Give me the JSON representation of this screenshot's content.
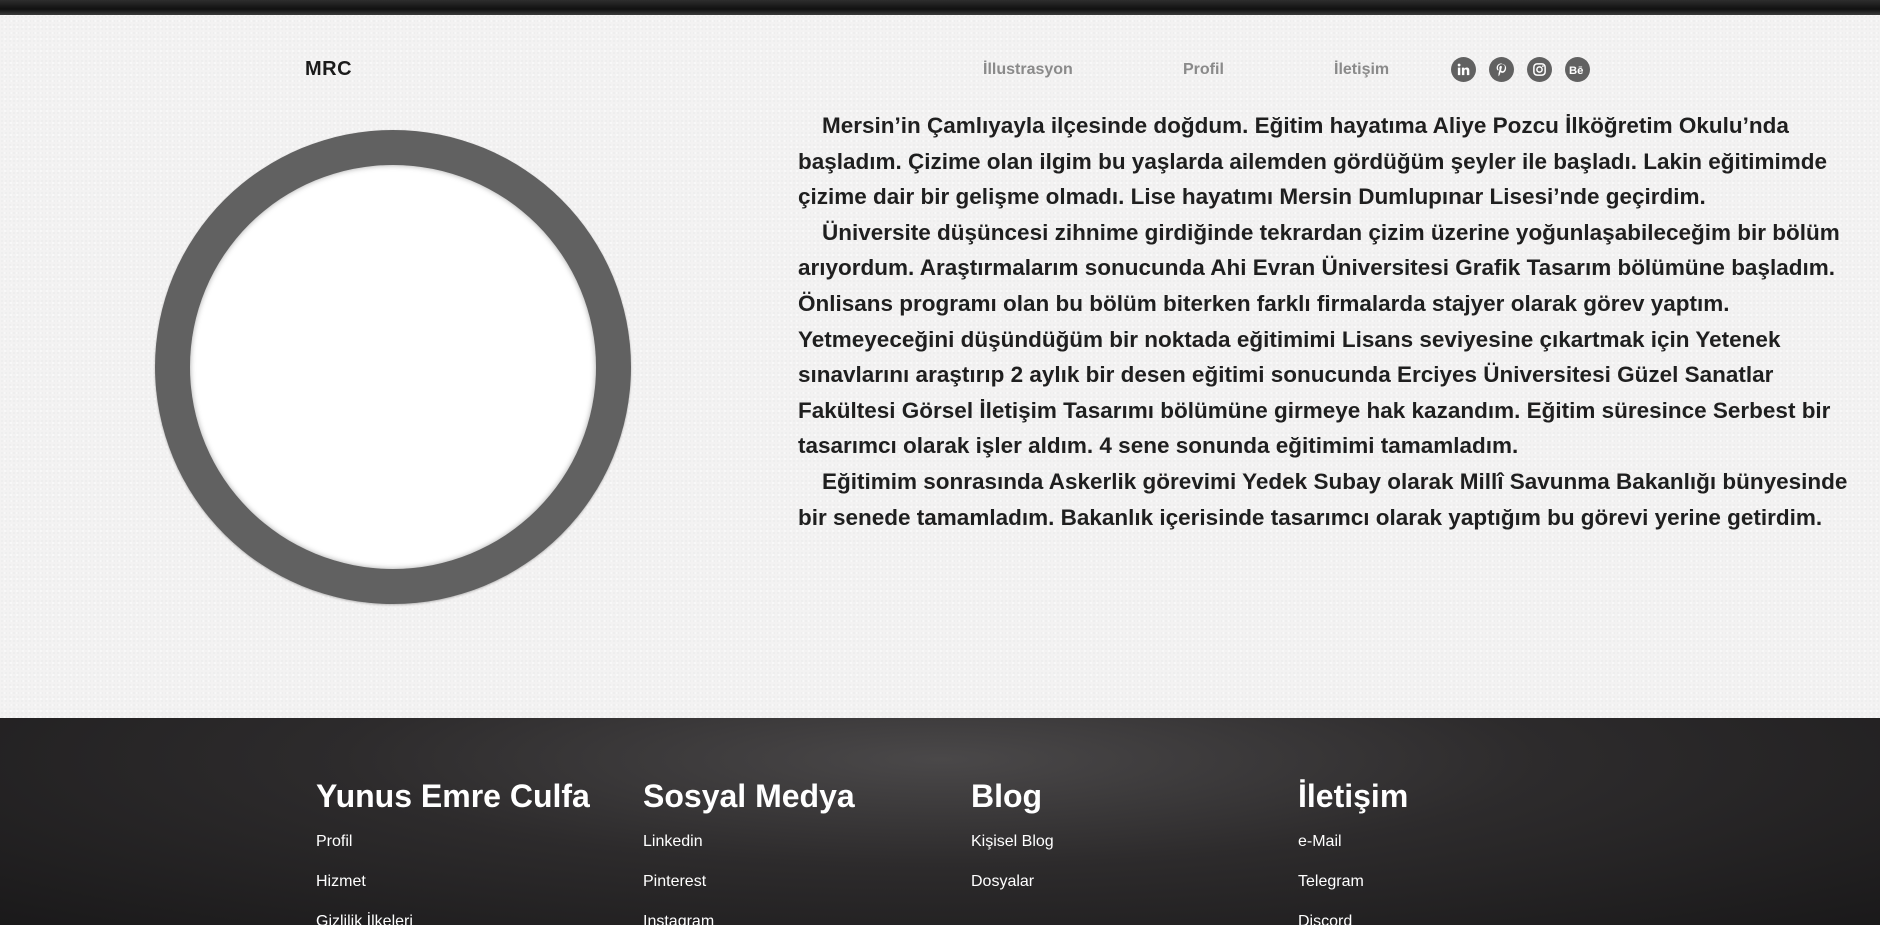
{
  "header": {
    "logo": "MRC",
    "nav": [
      "İllustrasyon",
      "Profil",
      "İletişim"
    ],
    "social_icons": [
      "linkedin-icon",
      "pinterest-icon",
      "instagram-icon",
      "behance-icon"
    ]
  },
  "bio": {
    "paragraphs": [
      "Mersin’in Çamlıyayla ilçesinde doğdum. Eğitim hayatıma Aliye Pozcu İlköğretim Okulu’nda başladım. Çizime olan ilgim bu yaşlarda ailemden gördüğüm şeyler ile başladı. Lakin eğitimimde çizime dair bir gelişme olmadı. Lise hayatımı Mersin Dumlupınar Lisesi’nde geçirdim.",
      "Üniversite düşüncesi zihnime girdiğinde tekrardan çizim üzerine yoğunlaşabileceğim bir bölüm arıyordum. Araştırmalarım sonucunda Ahi Evran Üniversitesi Grafik Tasarım bölümüne başladım. Önlisans programı olan bu bölüm biterken farklı firmalarda stajyer olarak görev yaptım. Yetmeyeceğini düşündüğüm bir noktada eğitimimi Lisans seviyesine çıkartmak için Yetenek sınavlarını araştırıp 2 aylık bir desen eğitimi sonucunda Erciyes Üniversitesi Güzel Sanatlar Fakültesi Görsel İletişim Tasarımı bölümüne girmeye hak kazandım. Eğitim süresince Serbest bir tasarımcı olarak işler aldım. 4 sene sonunda eğitimimi tamamladım.",
      "Eğitimim sonrasında Askerlik görevimi Yedek Subay olarak Millî Savunma Bakanlığı bünyesinde bir senede tamamladım. Bakanlık içerisinde tasarımcı olarak yaptığım bu görevi yerine getirdim."
    ]
  },
  "footer": {
    "columns": [
      {
        "title": "Yunus Emre Culfa",
        "links": [
          "Profil",
          "Hizmet",
          "Gizlilik İlkeleri"
        ]
      },
      {
        "title": "Sosyal Medya",
        "links": [
          "Linkedin",
          "Pinterest",
          "Instagram"
        ]
      },
      {
        "title": "Blog",
        "links": [
          "Kişisel Blog",
          "Dosyalar"
        ]
      },
      {
        "title": "İletişim",
        "links": [
          "e-Mail",
          "Telegram",
          "Discord"
        ]
      }
    ]
  },
  "colors": {
    "accent_gray": "#616161",
    "nav_text": "#8a8a8a",
    "footer_bg": "#2d2b2c"
  }
}
